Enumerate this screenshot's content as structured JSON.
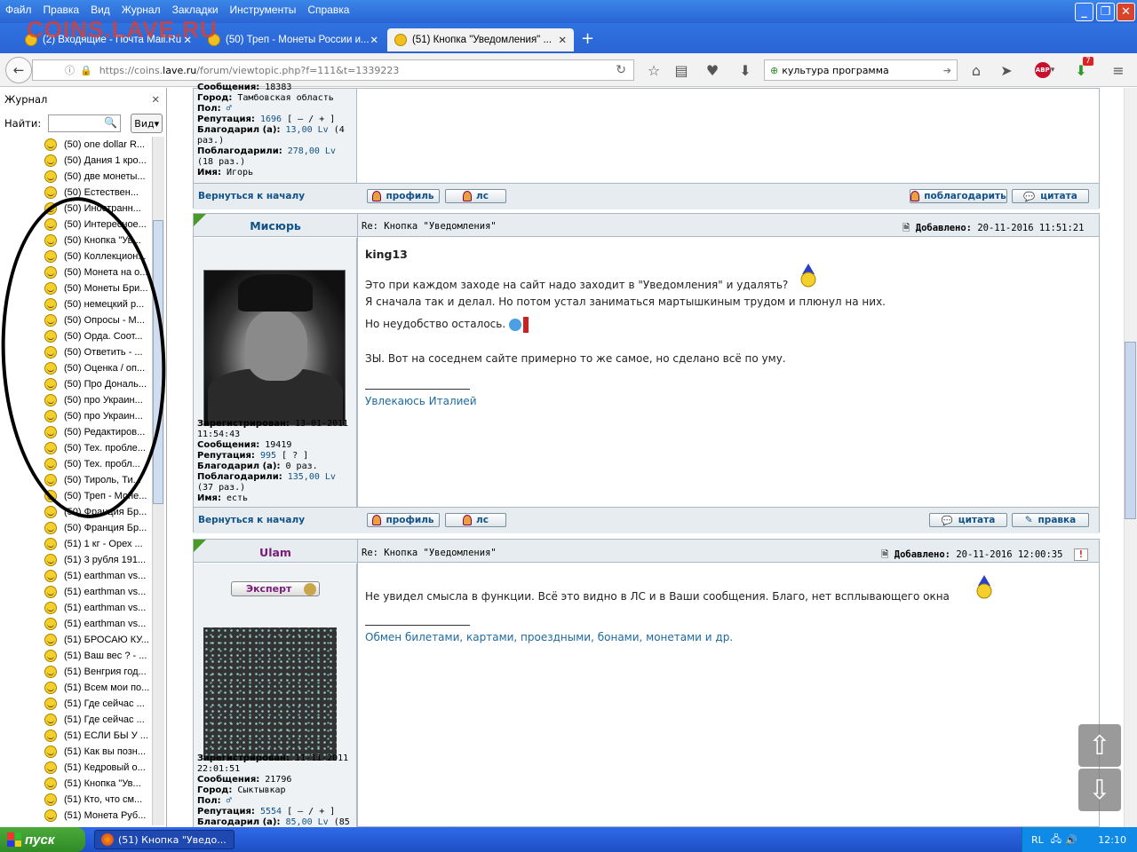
{
  "window": {
    "menu": [
      "Файл",
      "Правка",
      "Вид",
      "Журнал",
      "Закладки",
      "Инструменты",
      "Справка"
    ],
    "watermark": "COINS.LAVE.RU",
    "tabs": [
      {
        "label": "(2) Входящие - Почта Mail.Ru",
        "active": false
      },
      {
        "label": "(50) Треп - Монеты России и...",
        "active": false
      },
      {
        "label": "(51) Кнопка \"Уведомления\" ...",
        "active": true
      }
    ],
    "new_tab": "+"
  },
  "nav": {
    "url_prefix": "https://coins.",
    "url_host": "lave.ru",
    "url_path": "/forum/viewtopic.php?f=111&t=1339223",
    "search_value": "культура программа",
    "badge_count": "7",
    "abp_label": "ABP"
  },
  "sidebar": {
    "title": "Журнал",
    "find_label": "Найти:",
    "view_label": "Вид",
    "items": [
      "(50) one dollar R...",
      "(50) Дания 1 кро...",
      "(50) две монеты...",
      "(50) Естествен...",
      "(50) Иностранн...",
      "(50) Интересное...",
      "(50) Кнопка \"Ув...",
      "(50) Коллекцион...",
      "(50) Монета на о...",
      "(50) Монеты Бри...",
      "(50) немецкий р...",
      "(50) Опросы - М...",
      "(50) Орда. Соот...",
      "(50) Ответить - ...",
      "(50) Оценка / оп...",
      "(50) Про Дональ...",
      "(50) про Украин...",
      "(50) про Украин...",
      "(50) Редактиров...",
      "(50) Тех. пробле...",
      "(50) Тех. пробл...",
      "(50) Тироль, Ти...",
      "(50) Треп - Моне...",
      "(50) Франция Бр...",
      "(50) Франция Бр...",
      "(51) 1 кг - Орех ...",
      "(51) 3 рубля 191...",
      "(51) earthman vs...",
      "(51) earthman vs...",
      "(51) earthman vs...",
      "(51) earthman vs...",
      "(51) БРОСАЮ КУ...",
      "(51) Ваш вес ? - ...",
      "(51) Венгрия год...",
      "(51) Всем мои по...",
      "(51) Где сейчас ...",
      "(51) Где сейчас ...",
      "(51) ЕСЛИ БЫ У ...",
      "(51) Как вы позн...",
      "(51) Кедровый о...",
      "(51) Кнопка \"Ув...",
      "(51) Кто, что см...",
      "(51) Монета Руб..."
    ]
  },
  "post0": {
    "messages_label": "Сообщения:",
    "messages_value": "18383",
    "city_label": "Город:",
    "city": "Тамбовская область",
    "gender_label": "Пол:",
    "rep_label": "Репутация:",
    "rep": "1696",
    "rep_ctrl": "[ – / + ]",
    "thanked_label": "Благодарил (а):",
    "thanked": "13,00 Lv",
    "thanked_count": "(4 раз.)",
    "got_label": "Поблагодарили:",
    "got": "278,00 Lv",
    "got_count": "(18 раз.)",
    "name_label": "Имя:",
    "name": "Игорь",
    "back_top": "Вернуться к началу",
    "btn_profile": "профиль",
    "btn_pm": "лс",
    "btn_thank": "поблагодарить",
    "btn_quote": "цитата"
  },
  "post1": {
    "username": "Мисюрь",
    "subject": "Re: Кнопка \"Уведомления\"",
    "added_label": "Добавлено:",
    "added": "20-11-2016 11:51:21",
    "reg_label": "Зарегистрирован:",
    "reg": "13-01-2011 11:54:43",
    "messages_label": "Сообщения:",
    "messages": "19419",
    "rep_label": "Репутация:",
    "rep": "995",
    "rep_ctrl": "[ ? ]",
    "thanked_label": "Благодарил (а):",
    "thanked": "0 раз.",
    "got_label": "Поблагодарили:",
    "got": "135,00 Lv",
    "got_count": "(37 раз.)",
    "name_label": "Имя:",
    "name": "есть",
    "quote_author": "king13",
    "line1": "Это при каждом заходе на сайт надо заходит в \"Уведомления\" и удалять?",
    "line2": "Я сначала так и делал. Но потом устал заниматься мартышкиным трудом и плюнул на них.",
    "line3": "Но неудобство осталось.",
    "line4": "ЗЫ. Вот на соседнем сайте примерно то же самое, но сделано всё по уму.",
    "signature": "Увлекаюсь Италией",
    "back_top": "Вернуться к началу",
    "btn_profile": "профиль",
    "btn_pm": "лс",
    "btn_quote": "цитата",
    "btn_edit": "правка"
  },
  "post2": {
    "username": "Ulam",
    "badge": "Эксперт",
    "subject": "Re: Кнопка \"Уведомления\"",
    "added_label": "Добавлено:",
    "added": "20-11-2016 12:00:35",
    "reg_label": "Зарегистрирован:",
    "reg": "11-11-2011 22:01:51",
    "messages_label": "Сообщения:",
    "messages": "21796",
    "city_label": "Город:",
    "city": "Сыктывкар",
    "gender_label": "Пол:",
    "rep_label": "Репутация:",
    "rep": "5554",
    "rep_ctrl": "[ – / + ]",
    "thanked_label": "Благодарил (а):",
    "thanked": "85,00 Lv",
    "thanked_count": "(85",
    "line1": "Не увидел смысла в функции. Всё это видно в ЛС и в Ваши сообщения. Благо, нет всплывающего окна",
    "signature": "Обмен билетами, картами, проездными, бонами, монетами и др."
  },
  "taskbar": {
    "start": "пуск",
    "task": "(51) Кнопка \"Уведо...",
    "lang": "RL",
    "time": "12:10"
  },
  "colors": {
    "link": "#105289",
    "accent": "#2a64d4",
    "corner": "#4a9a2a",
    "ulam": "#7a1a7a"
  }
}
